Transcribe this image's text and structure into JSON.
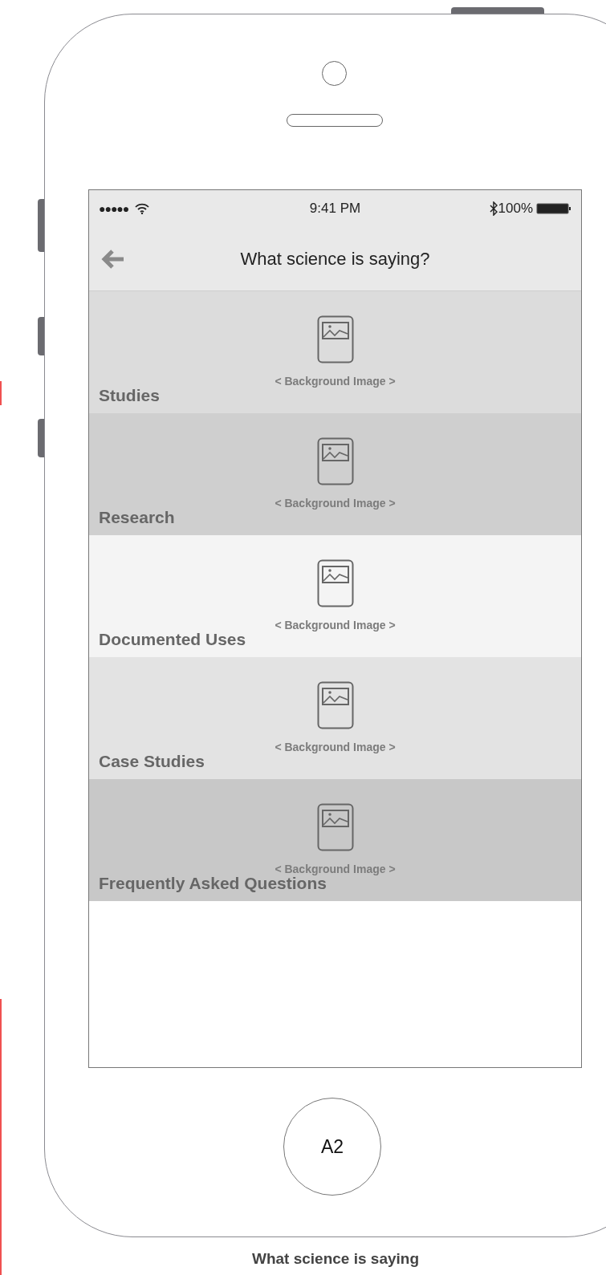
{
  "status_bar": {
    "signal_dots": "●●●●●",
    "time": "9:41 PM",
    "battery": "100%"
  },
  "nav": {
    "title": "What science is saying?"
  },
  "rows": [
    {
      "label": "Studies",
      "placeholder": "< Background Image >",
      "color": "#dcdcdc"
    },
    {
      "label": "Research",
      "placeholder": "< Background Image >",
      "color": "#cfcfcf"
    },
    {
      "label": "Documented Uses",
      "placeholder": "< Background Image >",
      "color": "#f4f4f4"
    },
    {
      "label": "Case Studies",
      "placeholder": "< Background Image >",
      "color": "#e3e3e3"
    },
    {
      "label": "Frequently Asked Questions",
      "placeholder": "< Background Image >",
      "color": "#c8c8c8"
    }
  ],
  "home_button": {
    "label": "A2"
  },
  "caption": "What science is saying"
}
